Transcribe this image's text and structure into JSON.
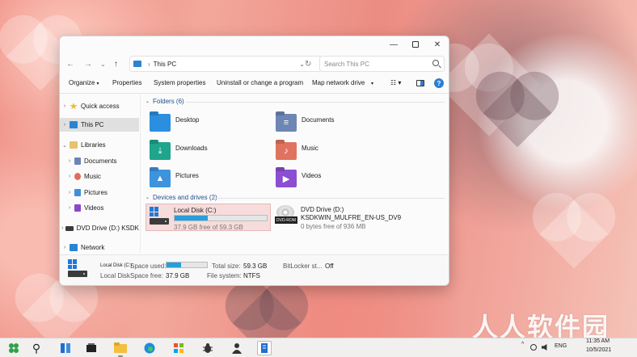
{
  "window": {
    "minimize": "—",
    "close": "✕"
  },
  "address": {
    "path": "This PC",
    "separator": "›",
    "dropdown": "⌄",
    "refresh": "↻"
  },
  "search": {
    "placeholder": "Search This PC"
  },
  "nav_buttons": {
    "back": "←",
    "forward": "→",
    "recent": "⌄",
    "up": "↑"
  },
  "commands": {
    "organize": "Organize",
    "properties": "Properties",
    "system_properties": "System properties",
    "uninstall": "Uninstall or change a program",
    "map_drive": "Map network drive",
    "more": "▾",
    "view": "☷ ▾",
    "help": "?"
  },
  "sidebar": {
    "items": [
      {
        "label": "Quick access",
        "chevron": "›",
        "icon_color": "#f2b82e"
      },
      {
        "label": "This PC",
        "chevron": "›",
        "icon_color": "#2a84d2"
      },
      {
        "label": "Libraries",
        "chevron": "⌄",
        "icon_color": "#e8c36b"
      },
      {
        "label": "Documents",
        "chevron": "›",
        "icon_color": "#6b85b8"
      },
      {
        "label": "Music",
        "chevron": "›",
        "icon_color": "#e26b5e"
      },
      {
        "label": "Pictures",
        "chevron": "›",
        "icon_color": "#3d8fd9"
      },
      {
        "label": "Videos",
        "chevron": "›",
        "icon_color": "#8a48c8"
      },
      {
        "label": "DVD Drive (D:) KSDK",
        "chevron": "›",
        "icon_color": "#3b3b3b"
      },
      {
        "label": "Network",
        "chevron": "›",
        "icon_color": "#2a84d2"
      }
    ]
  },
  "folders": {
    "header": "Folders (6)",
    "chevron": "⌄",
    "items": [
      {
        "label": "Desktop",
        "color": "#2b8fe0",
        "glyph": ""
      },
      {
        "label": "Documents",
        "color": "#6e86b4",
        "glyph": "≡"
      },
      {
        "label": "Downloads",
        "color": "#1ea58c",
        "glyph": "⤓"
      },
      {
        "label": "Music",
        "color": "#e0735f",
        "glyph": "♪"
      },
      {
        "label": "Pictures",
        "color": "#3c93de",
        "glyph": "▲"
      },
      {
        "label": "Videos",
        "color": "#8b4ed0",
        "glyph": "▶"
      }
    ]
  },
  "drives": {
    "header": "Devices and drives (2)",
    "chevron": "⌄",
    "local": {
      "name": "Local Disk (C:)",
      "free_text": "37.9 GB free of 59.3 GB",
      "used_fraction": 0.36
    },
    "dvd": {
      "name": "DVD Drive (D:)",
      "label": "KSDKWIN_MULFRE_EN-US_DV9",
      "free_text": "0 bytes free of 936 MB",
      "tag": "DVD-ROM"
    }
  },
  "details": {
    "name": "Local Disk (C:)",
    "type": "Local Disk",
    "space_used_label": "Space used:",
    "space_free_label": "Space free:",
    "space_free": "37.9 GB",
    "total_size_label": "Total size:",
    "total_size": "59.3 GB",
    "file_system_label": "File system:",
    "file_system": "NTFS",
    "bitlocker_label": "BitLocker st...",
    "bitlocker": "Off",
    "used_fraction": 0.36
  },
  "taskbar": {
    "search_glyph": "⚲",
    "tray": {
      "chevron": "^",
      "lang": "ENG",
      "time": "11:35 AM",
      "date": "10/5/2021"
    }
  },
  "watermark": "人人软件园"
}
